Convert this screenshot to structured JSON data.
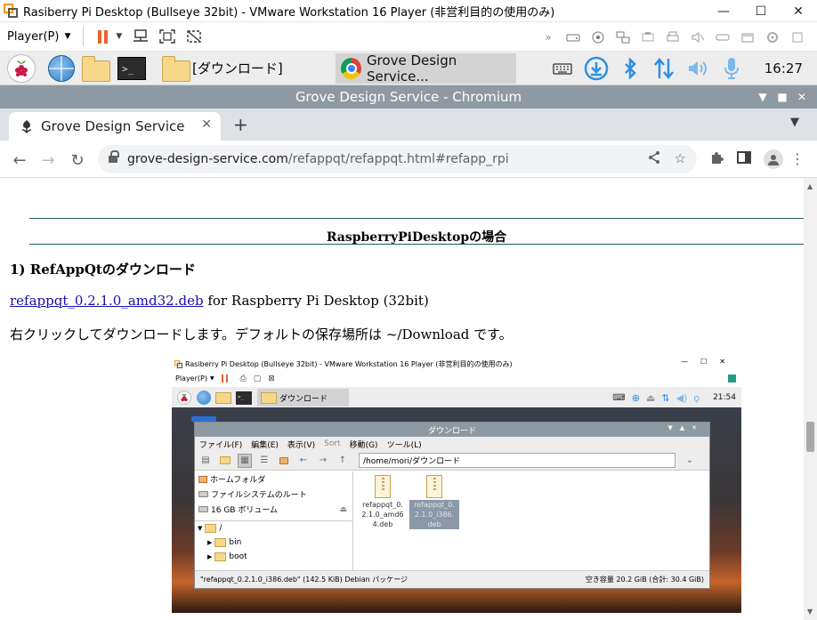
{
  "vmware": {
    "title": "Rasiberry Pi Desktop (Bullseye 32bit) - VMware Workstation 16 Player (非営利目的の使用のみ)",
    "player_menu": "Player(P)",
    "more_icon": "»",
    "window_controls": {
      "minimize": "—",
      "maximize": "☐",
      "close": "✕"
    }
  },
  "taskbar": {
    "folder_task": "[ダウンロード]",
    "chromium_task": "Grove Design Service...",
    "clock": "16:27",
    "terminal_glyph": ">_"
  },
  "chromium": {
    "window_title": "Grove Design Service - Chromium",
    "tab_title": "Grove Design Service",
    "url_host": "grove-design-service.com",
    "url_path": "/refappqt/refappqt.html#refapp_rpi"
  },
  "page": {
    "section_heading": "RaspberryPiDesktopの場合",
    "sub_heading": "1) RefAppQtのダウンロード",
    "download_link": "refappqt_0.2.1.0_amd32.deb",
    "download_suffix": " for Raspberry Pi Desktop (32bit)",
    "instruction": "右クリックしてダウンロードします。デフォルトの保存場所は ~/Download です。"
  },
  "screenshot": {
    "vm_title": "Rasiberry Pi Desktop (Bullseye 32bit) - VMware Workstation 16 Player (非営利目的の使用のみ)",
    "player_menu": "Player(P)",
    "folder_task": "ダウンロード",
    "clock": "21:54",
    "file_manager": {
      "title": "ダウンロード",
      "menu": [
        "ファイル(F)",
        "編集(E)",
        "表示(V)",
        "Sort",
        "移動(G)",
        "ツール(L)"
      ],
      "path": "/home/mori/ダウンロード",
      "places": [
        "ホームフォルダ",
        "ファイルシステムのルート",
        "16 GB ボリューム"
      ],
      "tree": [
        "/",
        "bin",
        "boot"
      ],
      "files": [
        {
          "name": "refappqt_0.2.1.0_amd64.deb",
          "line1": "refappqt_0.",
          "line2": "2.1.0_amd6",
          "line3": "4.deb"
        },
        {
          "name": "refappqt_0.2.1.0_i386.deb",
          "line1": "refappqt_0.",
          "line2": "2.1.0_i386.",
          "line3": "deb"
        }
      ],
      "status_left": "\"refappqt_0.2.1.0_i386.deb\" (142.5 KiB) Debian パッケージ",
      "status_right": "空き容量 20.2 GiB (合計: 30.4 GiB)"
    }
  }
}
